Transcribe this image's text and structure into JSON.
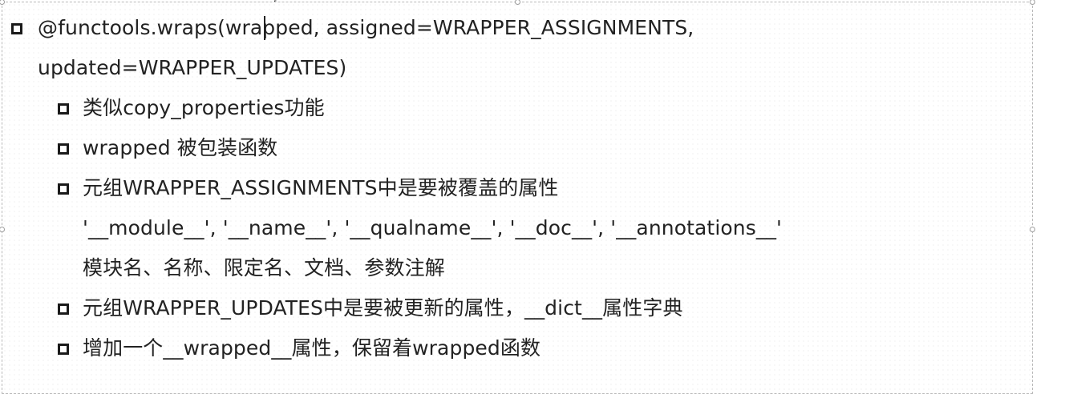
{
  "slide": {
    "heading_line1": "@functools.wraps(wrapped, assigned=WRAPPER_ASSIGNMENTS,",
    "heading_line2": "updated=WRAPPER_UPDATES)",
    "items": [
      {
        "text": "类似copy_properties功能"
      },
      {
        "text": "wrapped 被包装函数"
      },
      {
        "text": "元组WRAPPER_ASSIGNMENTS中是要被覆盖的属性",
        "continuation": [
          "'__module__', '__name__', '__qualname__', '__doc__', '__annotations__'",
          "模块名、名称、限定名、文档、参数注解"
        ]
      },
      {
        "text": "元组WRAPPER_UPDATES中是要被更新的属性，__dict__属性字典"
      },
      {
        "text": "增加一个__wrapped__属性，保留着wrapped函数"
      }
    ]
  },
  "icons": {
    "bullet": "hollow-square-bullet-icon",
    "cursor": "text-cursor-icon"
  },
  "colors": {
    "text": "#222222",
    "bullet": "#1a1a1a",
    "frame_border": "#b9b9b9"
  }
}
